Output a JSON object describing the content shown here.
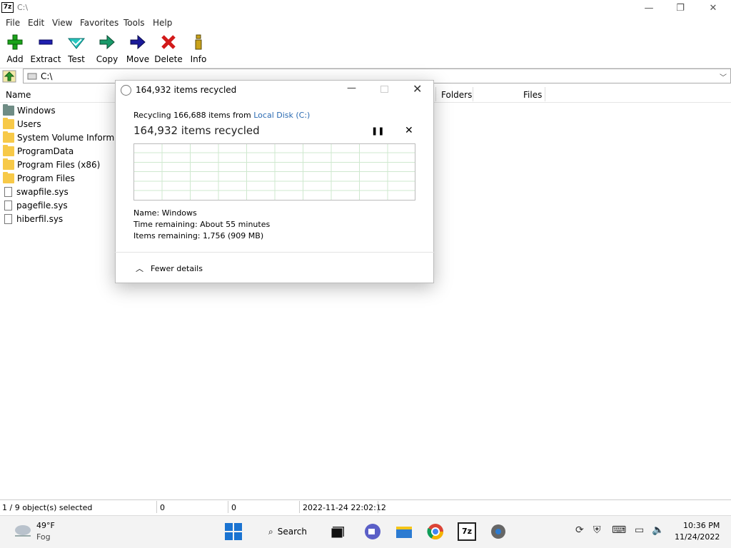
{
  "window": {
    "title": "C:\\",
    "app_icon_text": "7z",
    "minimize": "—",
    "restore": "❐",
    "close": "✕"
  },
  "menu": [
    "File",
    "Edit",
    "View",
    "Favorites",
    "Tools",
    "Help"
  ],
  "toolbar": {
    "add": "Add",
    "extract": "Extract",
    "test": "Test",
    "copy": "Copy",
    "move": "Move",
    "delete": "Delete",
    "info": "Info"
  },
  "address": {
    "path": "C:\\"
  },
  "columns": {
    "name": "Name",
    "folders": "Folders",
    "files": "Files"
  },
  "items": [
    {
      "name": "Windows",
      "type": "system-folder"
    },
    {
      "name": "Users",
      "type": "folder"
    },
    {
      "name": "System Volume Informa...",
      "type": "folder"
    },
    {
      "name": "ProgramData",
      "type": "folder"
    },
    {
      "name": "Program Files (x86)",
      "type": "folder"
    },
    {
      "name": "Program Files",
      "type": "folder"
    },
    {
      "name": "swapfile.sys",
      "type": "file"
    },
    {
      "name": "pagefile.sys",
      "type": "file"
    },
    {
      "name": "hiberfil.sys",
      "type": "file"
    }
  ],
  "dialog": {
    "title": "164,932 items recycled",
    "recycling_prefix": "Recycling 166,688 items from",
    "source_link": "Local Disk (C:)",
    "big_status": "164,932 items recycled",
    "details": {
      "name": "Name:  Windows",
      "time_remaining": "Time remaining:  About 55 minutes",
      "items_remaining": "Items remaining:  1,756 (909 MB)"
    },
    "toggle_label": "Fewer details"
  },
  "statusbar": {
    "selection": "1 / 9 object(s) selected",
    "size": "0",
    "packed": "0",
    "modified": "2022-11-24 22:02:12"
  },
  "taskbar": {
    "weather_temp": "49°F",
    "weather_cond": "Fog",
    "search_label": "Search",
    "time": "10:36 PM",
    "date": "11/24/2022"
  },
  "colors": {
    "link": "#2a6ab2",
    "graph_grid": "#cfe8cf"
  }
}
